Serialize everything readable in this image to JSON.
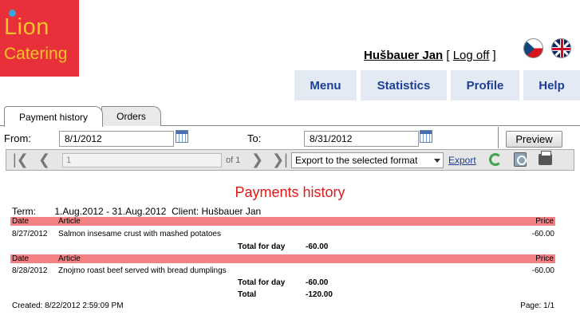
{
  "logo": {
    "line1": "Lion",
    "line2": "Catering"
  },
  "user": {
    "name": "Hušbauer Jan",
    "open_bracket": "[",
    "logoff": "Log off",
    "close_bracket": "]"
  },
  "flags": {
    "cz": "czech-flag-icon",
    "uk": "uk-flag-icon"
  },
  "nav": {
    "menu": "Menu",
    "statistics": "Statistics",
    "profile": "Profile",
    "help": "Help"
  },
  "tabs": {
    "payment_history": "Payment history",
    "orders": "Orders"
  },
  "filters": {
    "from_label": "From:",
    "from_value": "8/1/2012",
    "to_label": "To:",
    "to_value": "8/31/2012",
    "preview": "Preview"
  },
  "toolbar": {
    "page_value": "1",
    "of_pages": "of 1",
    "format": "Export to the selected format",
    "export": "Export"
  },
  "report": {
    "title": "Payments history",
    "term_label": "Term:",
    "term_value": "1.Aug.2012 - 31.Aug.2012",
    "client_label": "Client:",
    "client_value": "Hušbauer Jan",
    "col_date": "Date",
    "col_article": "Article",
    "col_price": "Price",
    "groups": [
      {
        "date": "8/27/2012",
        "article": "Salmon insesame crust with mashed potatoes",
        "price": "-60.00",
        "total_label": "Total for day",
        "total": "-60.00"
      },
      {
        "date": "8/28/2012",
        "article": "Znojmo roast beef served with bread dumplings",
        "price": "-60.00",
        "total_label": "Total for day",
        "total": "-60.00"
      }
    ],
    "grand_total_label": "Total",
    "grand_total": "-120.00",
    "created": "Created: 8/22/2012 2:59:09 PM",
    "page": "Page: 1/1"
  }
}
